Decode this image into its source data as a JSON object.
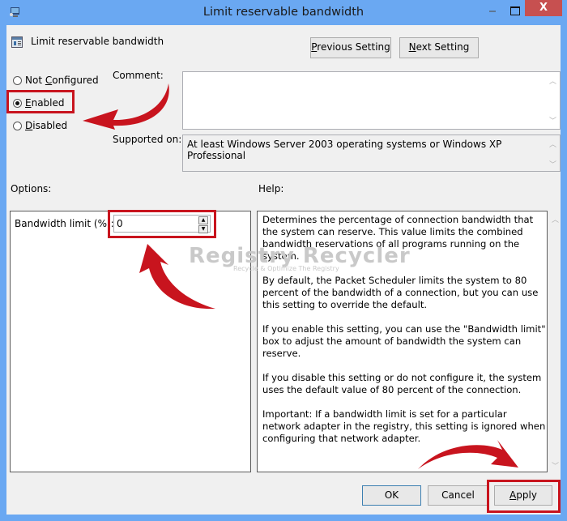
{
  "window": {
    "title": "Limit reservable bandwidth",
    "controls": {
      "minimize": "–",
      "maximize": "□",
      "close": "X"
    }
  },
  "header": {
    "policy_name": "Limit reservable bandwidth",
    "previous_button": {
      "prefix": "",
      "accel": "P",
      "rest": "revious Setting"
    },
    "next_button": {
      "prefix": "",
      "accel": "N",
      "rest": "ext Setting"
    }
  },
  "state": {
    "options": [
      {
        "pre": "Not ",
        "accel": "C",
        "post": "onfigured",
        "selected": false
      },
      {
        "pre": "",
        "accel": "E",
        "post": "nabled",
        "selected": true
      },
      {
        "pre": "",
        "accel": "D",
        "post": "isabled",
        "selected": false
      }
    ]
  },
  "comment": {
    "label": "Comment:",
    "value": ""
  },
  "supported": {
    "label": "Supported on:",
    "value": "At least Windows Server 2003 operating systems or Windows XP Professional"
  },
  "options_section": {
    "label": "Options:",
    "bandwidth_label": "Bandwidth limit (%):",
    "bandwidth_value": "0"
  },
  "help_section": {
    "label": "Help:",
    "paragraphs": [
      "Determines the percentage of connection bandwidth that the system can reserve. This value limits the combined bandwidth reservations of all programs running on the system.",
      "By default, the Packet Scheduler limits the system to 80 percent of the bandwidth of a connection, but you can use this setting to override the default.",
      "If you enable this setting, you can use the \"Bandwidth limit\" box to adjust the amount of bandwidth the system can reserve.",
      "If you disable this setting or do not configure it, the system uses the default value of 80 percent of the connection.",
      "Important: If a bandwidth limit is set for a particular network adapter in the registry, this setting is ignored when configuring that network adapter."
    ]
  },
  "footer": {
    "ok": "OK",
    "cancel": "Cancel",
    "apply": {
      "accel": "A",
      "rest": "pply"
    }
  },
  "watermark": {
    "title": "Registry Recycler",
    "subtitle": "Recycle & Optimize The Registry"
  },
  "annotations": {
    "highlight_color": "#c8141e",
    "arrow_color": "#c8141e"
  }
}
